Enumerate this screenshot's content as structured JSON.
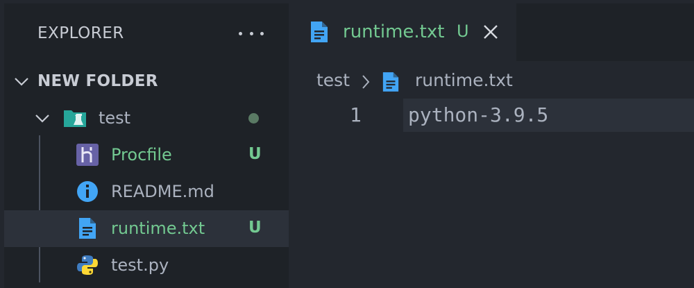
{
  "explorer": {
    "title": "EXPLORER",
    "folder": "NEW FOLDER",
    "items": [
      {
        "label": "test",
        "type": "folder",
        "icon": "test-folder-icon",
        "status": "dot"
      },
      {
        "label": "Procfile",
        "type": "file",
        "icon": "heroku-icon",
        "status": "U"
      },
      {
        "label": "README.md",
        "type": "file",
        "icon": "info-icon",
        "status": ""
      },
      {
        "label": "runtime.txt",
        "type": "file",
        "icon": "text-file-icon",
        "status": "U"
      },
      {
        "label": "test.py",
        "type": "file",
        "icon": "python-icon",
        "status": ""
      }
    ]
  },
  "editor": {
    "tab": {
      "label": "runtime.txt",
      "status": "U"
    },
    "breadcrumb": [
      "test",
      "runtime.txt"
    ],
    "lines": [
      {
        "number": "1",
        "text": "python-3.9.5"
      }
    ]
  },
  "colors": {
    "untracked": "#73c991",
    "file_icon": "#42a5f5",
    "heroku": "#6762a6"
  }
}
